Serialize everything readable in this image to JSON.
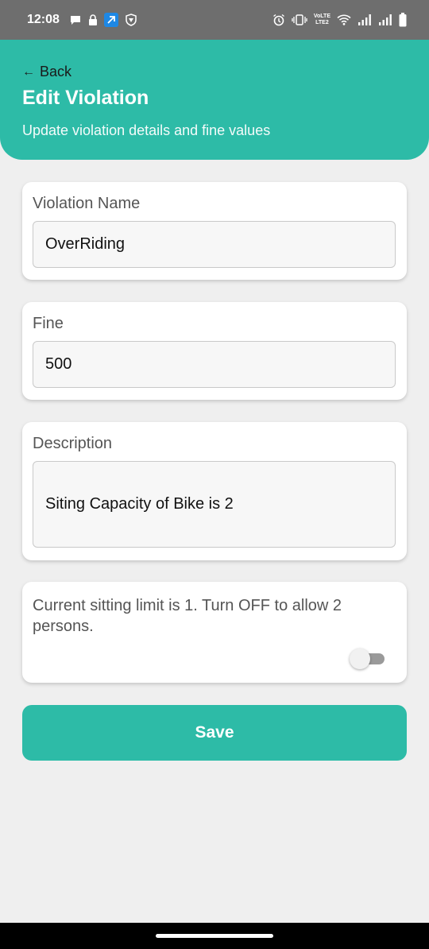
{
  "status_bar": {
    "time": "12:08",
    "lte_label_top": "VoLTE",
    "lte_label_bottom": "LTE2",
    "icons": [
      "chat-bubble-icon",
      "lock-icon",
      "app-icon",
      "vpn-shield-icon",
      "alarm-icon",
      "vibrate-icon",
      "wifi-icon",
      "signal-icon",
      "signal-icon",
      "battery-icon"
    ]
  },
  "header": {
    "back_arrow": "←",
    "back_label": "Back",
    "title": "Edit Violation",
    "subtitle": "Update violation details and fine values",
    "color": "#2dbba7"
  },
  "form": {
    "violation_name": {
      "label": "Violation Name",
      "value": "OverRiding"
    },
    "fine": {
      "label": "Fine",
      "value": "500"
    },
    "description": {
      "label": "Description",
      "value": "Siting Capacity of Bike is 2"
    },
    "sitting_limit": {
      "text": "Current sitting limit is 1. Turn OFF to allow 2 persons.",
      "toggle_on": false
    }
  },
  "actions": {
    "save_label": "Save"
  }
}
